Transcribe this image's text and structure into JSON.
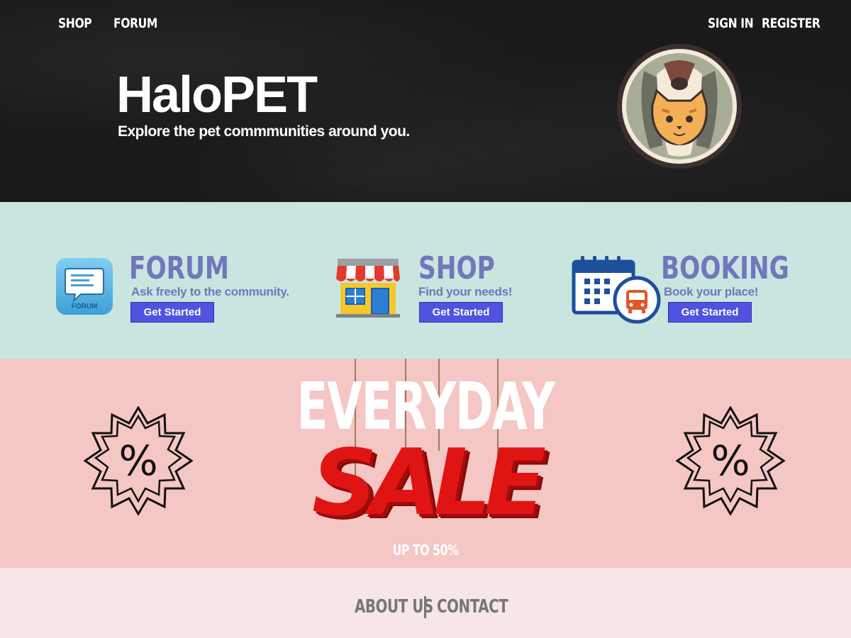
{
  "nav": {
    "left": [
      "SHOP",
      "FORUM"
    ],
    "right": [
      "SIGN IN",
      "REGISTER"
    ]
  },
  "hero": {
    "title": "HaloPET",
    "subtitle": "Explore the pet commmunities around you."
  },
  "services": [
    {
      "title": "FORUM",
      "description": "Ask freely to the community.",
      "button": "Get Started",
      "icon": "forum-chat-icon",
      "icon_caption": "FORUM"
    },
    {
      "title": "SHOP",
      "description": "Find your needs!",
      "button": "Get Started",
      "icon": "storefront-icon"
    },
    {
      "title": "BOOKING",
      "description": "Book your place!",
      "button": "Get Started",
      "icon": "calendar-bus-icon"
    }
  ],
  "sale": {
    "headline": "EVERYDAY",
    "word": "SALE",
    "sub": "UP TO 50%",
    "badge_symbol": "%"
  },
  "footer": {
    "links": [
      "ABOUT US",
      "CONTACT"
    ]
  },
  "colors": {
    "hero_bg": "#1a1a1a",
    "services_bg": "#c9e5df",
    "sale_bg": "#f4c6c4",
    "footer_bg": "#f6e6e7",
    "accent_text": "#6f77bd",
    "button": "#4f53e0",
    "sale_red": "#e11414"
  }
}
